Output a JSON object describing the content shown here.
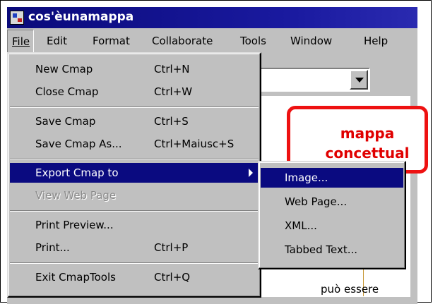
{
  "window": {
    "title": "cos'èunamappa"
  },
  "menubar": {
    "items": [
      {
        "label": "File"
      },
      {
        "label": "Edit"
      },
      {
        "label": "Format"
      },
      {
        "label": "Collaborate"
      },
      {
        "label": "Tools"
      },
      {
        "label": "Window"
      },
      {
        "label": "Help"
      }
    ]
  },
  "file_menu": {
    "items": [
      {
        "label": "New Cmap",
        "shortcut": "Ctrl+N"
      },
      {
        "label": "Close Cmap",
        "shortcut": "Ctrl+W"
      },
      {
        "label": "Save Cmap",
        "shortcut": "Ctrl+S"
      },
      {
        "label": "Save Cmap As...",
        "shortcut": "Ctrl+Maiusc+S"
      },
      {
        "label": "Export Cmap to",
        "shortcut": ""
      },
      {
        "label": "View Web Page",
        "shortcut": ""
      },
      {
        "label": "Print Preview...",
        "shortcut": ""
      },
      {
        "label": "Print...",
        "shortcut": "Ctrl+P"
      },
      {
        "label": "Exit CmapTools",
        "shortcut": "Ctrl+Q"
      }
    ]
  },
  "export_submenu": {
    "items": [
      {
        "label": "Image..."
      },
      {
        "label": "Web Page..."
      },
      {
        "label": "XML..."
      },
      {
        "label": "Tabbed Text..."
      }
    ]
  },
  "canvas": {
    "concept": {
      "line1": "mappa",
      "line2": "concettual"
    },
    "link_label": "può essere"
  },
  "colors": {
    "selection": "#0a0a80",
    "title_bar": "#0a0a7a",
    "concept_border": "#ee1111",
    "concept_text": "#e00000",
    "link": "#c89a3a"
  }
}
